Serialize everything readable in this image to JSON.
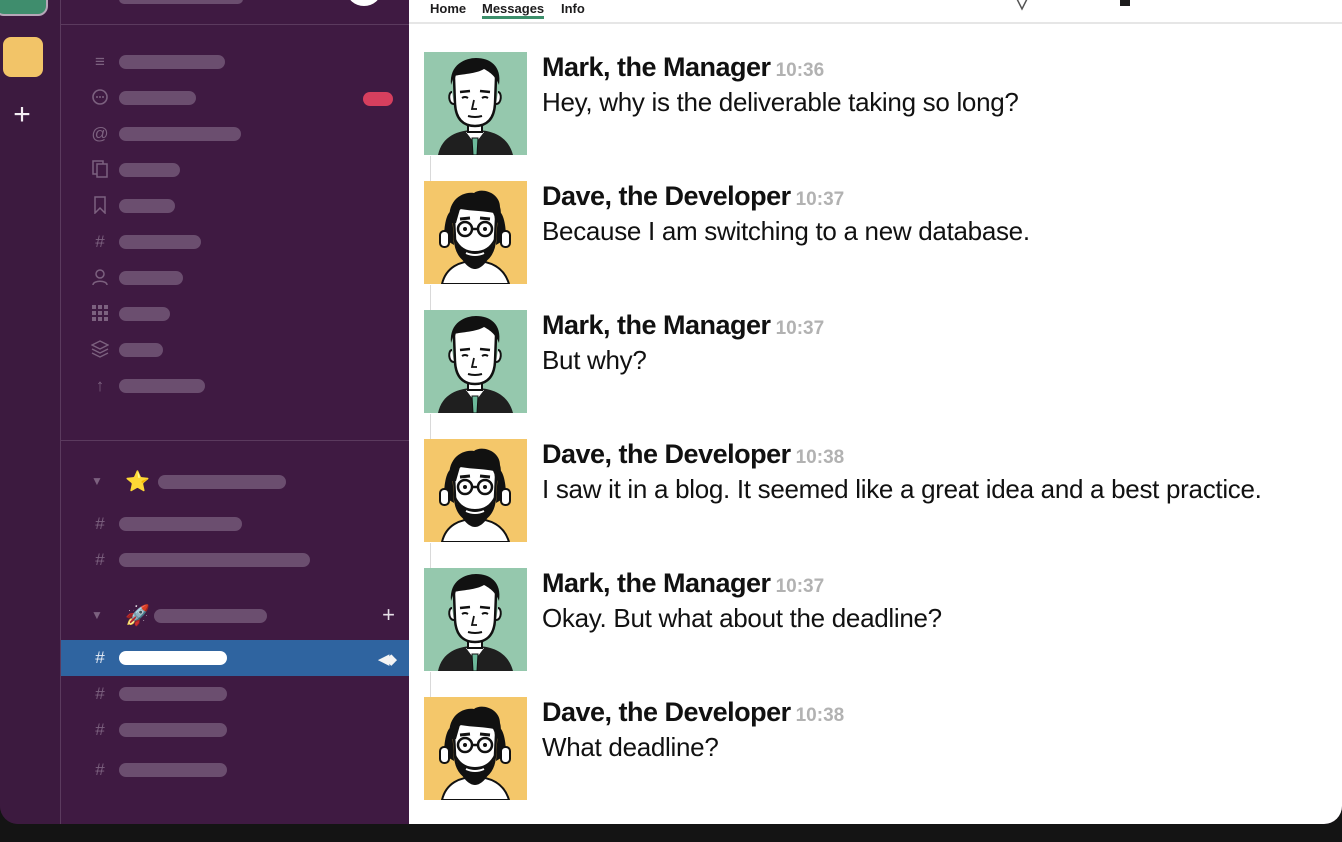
{
  "tabs": [
    "Home",
    "Messages",
    "Info"
  ],
  "colors": {
    "sidebar": "#3f1a42",
    "active": "#2f64a0",
    "badge": "#d63f5e",
    "workspace": "#f2c468",
    "manager_avatar_bg": "#95c8ad",
    "developer_avatar_bg": "#f4c76a"
  },
  "sidebar": {
    "icons": [
      "lines-icon",
      "threads-icon",
      "mention-icon",
      "files-icon",
      "bookmark-icon",
      "hash-icon",
      "person-icon",
      "apps-icon",
      "layers-icon",
      "arrow-up-icon"
    ],
    "starred_emoji": "⭐",
    "section_emoji": "🚀"
  },
  "messages": [
    {
      "author": "Mark, the Manager",
      "time": "10:36",
      "text": "Hey, why is the deliverable taking so long?",
      "avatar": "manager"
    },
    {
      "author": "Dave, the Developer",
      "time": "10:37",
      "text": "Because I am switching to a new database.",
      "avatar": "developer"
    },
    {
      "author": "Mark, the Manager",
      "time": "10:37",
      "text": "But why?",
      "avatar": "manager"
    },
    {
      "author": "Dave, the Developer",
      "time": "10:38",
      "text": "I saw it in a blog. It seemed like a great idea and a best practice.",
      "avatar": "developer"
    },
    {
      "author": "Mark, the Manager",
      "time": "10:37",
      "text": "Okay. But what about the deadline?",
      "avatar": "manager"
    },
    {
      "author": "Dave, the Developer",
      "time": "10:38",
      "text": "What deadline?",
      "avatar": "developer"
    }
  ]
}
